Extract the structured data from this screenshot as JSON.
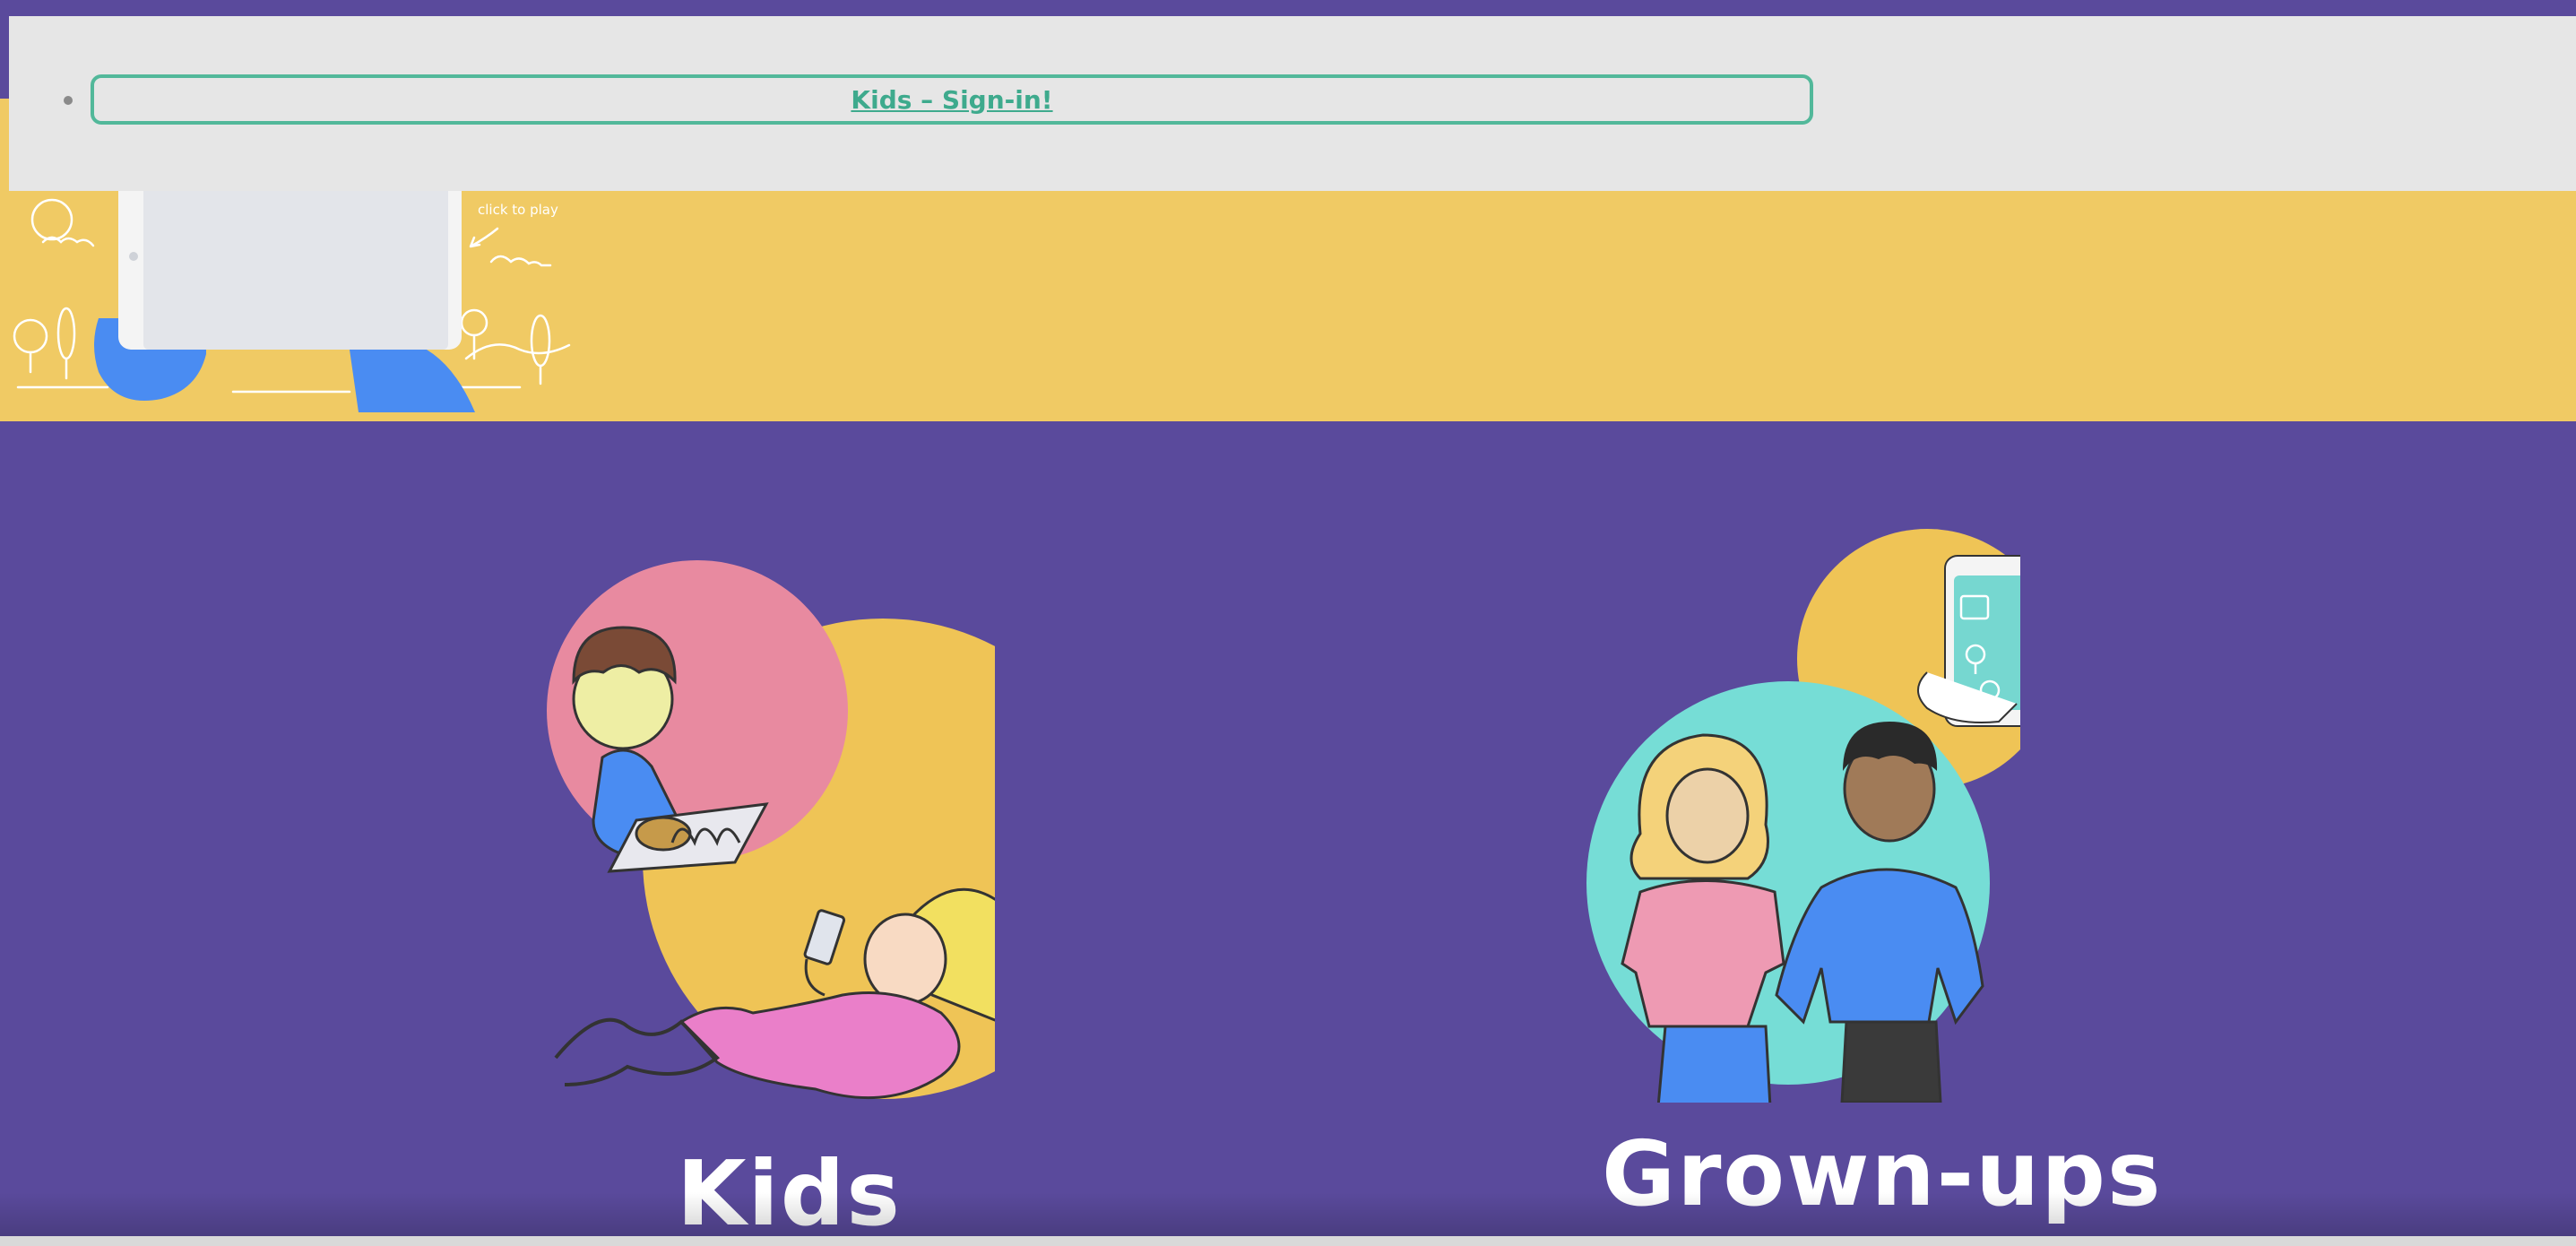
{
  "nav": {
    "signin_label": "Kids – Sign-in!"
  },
  "hero": {
    "play_hint": "click to play"
  },
  "cards": {
    "kids_title": "Kids",
    "grownups_title": "Grown-ups"
  },
  "colors": {
    "page_bg": "#5a4a9c",
    "hero_bg": "#f0ca64",
    "nav_bg": "#e6e6e6",
    "link": "#3eaa8d"
  },
  "icons": {
    "video_preview": "tablet-play-icon",
    "kids_image": "kids-illustration",
    "grownups_image": "grownups-illustration"
  }
}
